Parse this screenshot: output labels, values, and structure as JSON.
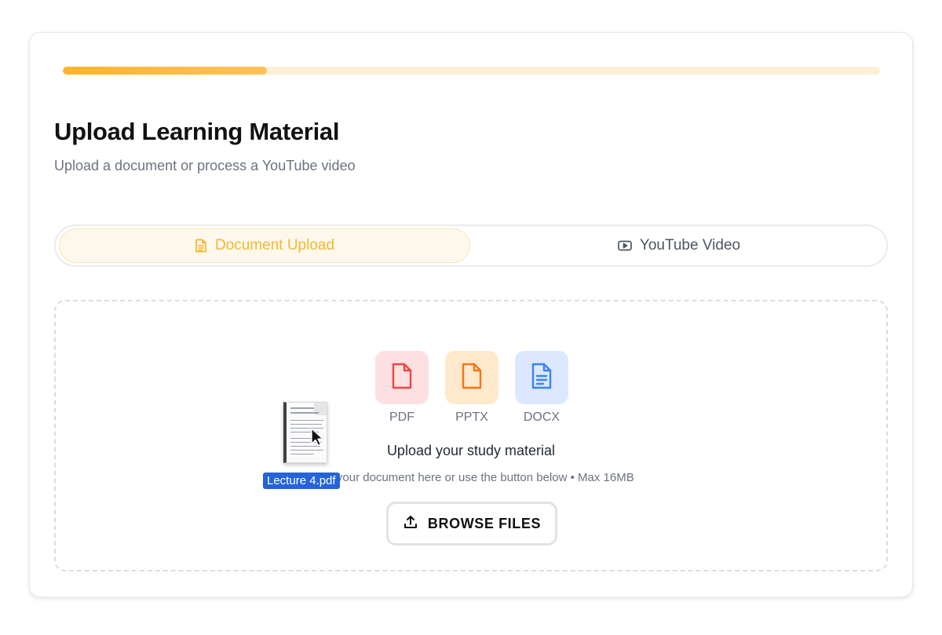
{
  "progress": {
    "value_percent": 25
  },
  "header": {
    "title": "Upload Learning Material",
    "subtitle": "Upload a document or process a YouTube video"
  },
  "tabs": [
    {
      "label": "Document Upload",
      "icon": "document-icon",
      "active": true
    },
    {
      "label": "YouTube Video",
      "icon": "video-play-icon",
      "active": false
    }
  ],
  "dropzone": {
    "file_types": [
      {
        "label": "PDF",
        "icon": "pdf-file-icon",
        "color": "#ef4444"
      },
      {
        "label": "PPTX",
        "icon": "pptx-file-icon",
        "color": "#f97316"
      },
      {
        "label": "DOCX",
        "icon": "docx-file-icon",
        "color": "#3b82f6"
      }
    ],
    "heading": "Upload your study material",
    "hint": "Drag your document here or use the button below • Max 16MB",
    "browse_label": "BROWSE FILES",
    "browse_icon": "upload-icon"
  },
  "drag": {
    "file_name": "Lecture 4.pdf",
    "icon": "pdf-thumbnail-icon"
  },
  "colors": {
    "accent": "#fbb426",
    "active_tab_text": "#f6b730",
    "pdf": "#ef4444",
    "pptx": "#f97316",
    "docx": "#3b82f6"
  }
}
